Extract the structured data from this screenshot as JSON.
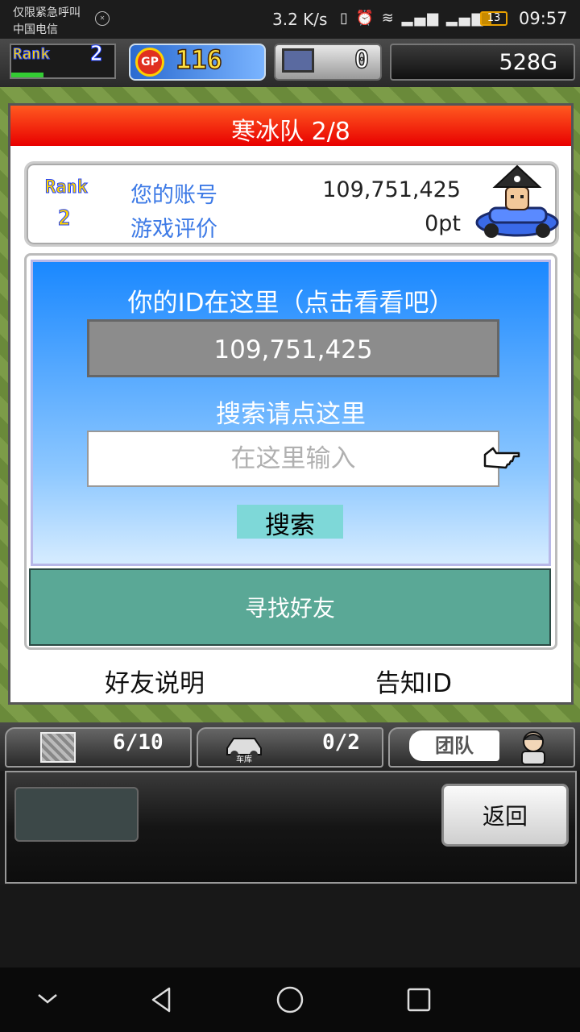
{
  "status_bar": {
    "carrier_line1": "仅限紧急呼叫",
    "carrier_line2": "中国电信",
    "net_speed": "3.2 K/s",
    "battery": "13",
    "time": "09:57"
  },
  "hud": {
    "rank_label": "Rank",
    "rank_value": "2",
    "gp_icon_label": "GP",
    "gp_value": "116",
    "pc_value": "0",
    "money": "528G"
  },
  "dialog": {
    "title": "寒冰队 2/8",
    "profile": {
      "rank_label": "Rank",
      "rank_value": "2",
      "account_label": "您的账号",
      "account_value": "109,751,425",
      "rating_label": "游戏评价",
      "rating_value": "0pt"
    },
    "id_heading": "你的ID在这里（点击看看吧）",
    "id_value": "109,751,425",
    "search_heading": "搜索请点这里",
    "search_placeholder": "在这里输入",
    "search_button": "搜索",
    "find_friend_button": "寻找好友",
    "friend_help_link": "好友说明",
    "notify_id_link": "告知ID"
  },
  "bottom_hud": {
    "box_count": "6/10",
    "garage_label": "车库",
    "garage_count": "0/2",
    "team_tab": "团队",
    "back_button": "返回"
  },
  "colors": {
    "title_red": "#e80000",
    "panel_blue": "#1a88ff",
    "teal_button": "#5aa896",
    "label_blue": "#3d7ae6"
  }
}
